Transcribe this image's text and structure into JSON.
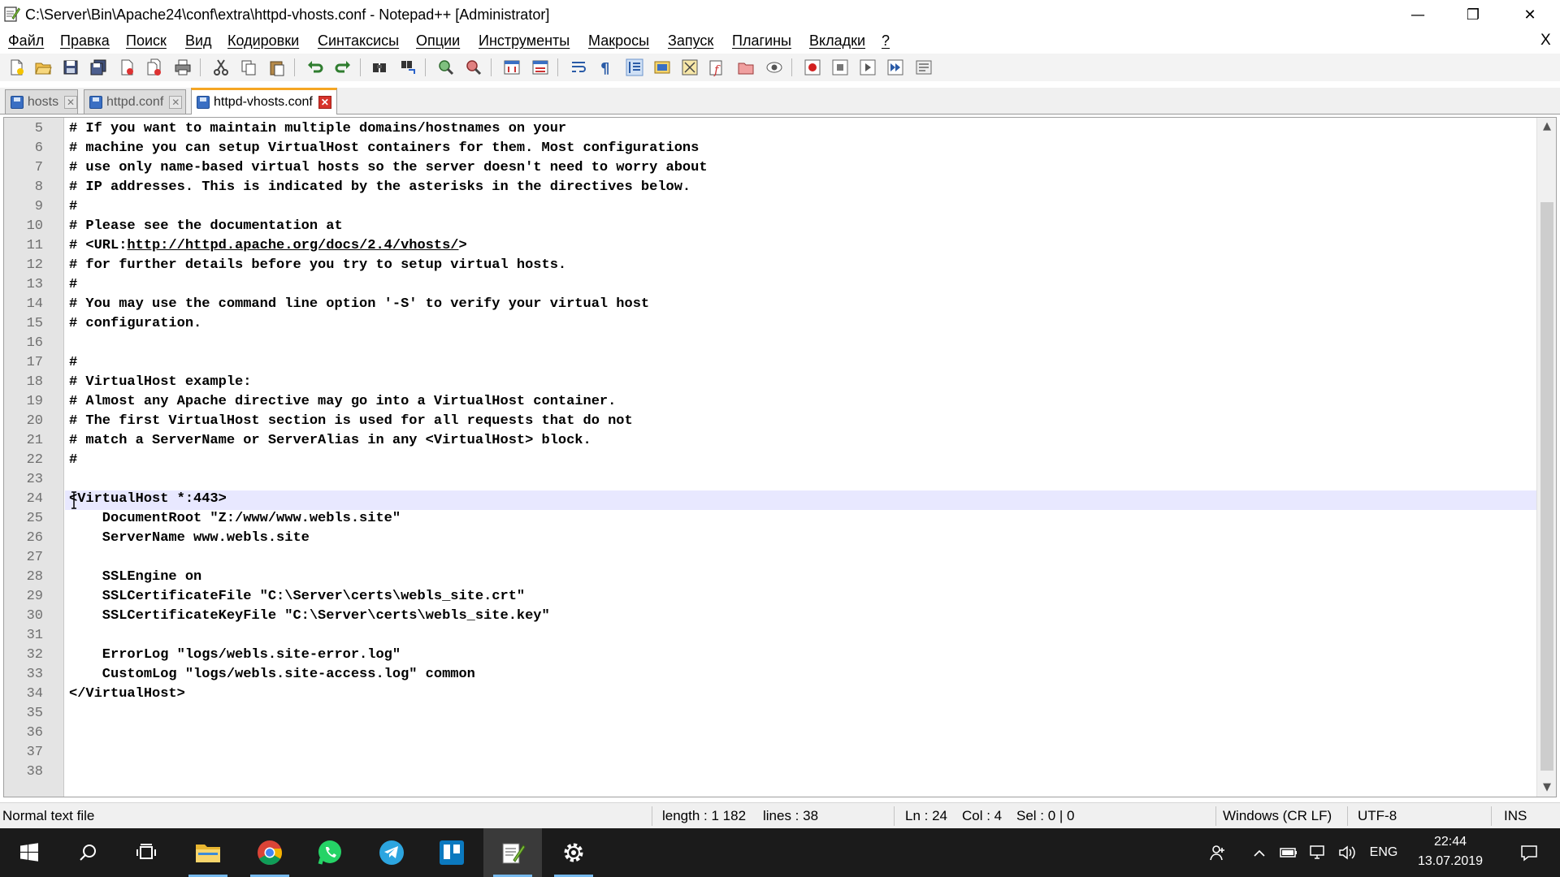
{
  "window": {
    "title": "C:\\Server\\Bin\\Apache24\\conf\\extra\\httpd-vhosts.conf - Notepad++ [Administrator]",
    "controls": {
      "minimize": "—",
      "maximize": "❐",
      "close": "✕"
    }
  },
  "menu": {
    "items": [
      "Файл",
      "Правка",
      "Поиск",
      "Вид",
      "Кодировки",
      "Синтаксисы",
      "Опции",
      "Инструменты",
      "Макросы",
      "Запуск",
      "Плагины",
      "Вкладки",
      "?"
    ],
    "close_doc": "X"
  },
  "toolbar": {
    "icons": [
      "new-file-icon",
      "open-file-icon",
      "save-icon",
      "save-all-icon",
      "close-icon",
      "close-all-icon",
      "print-icon",
      "cut-icon",
      "copy-icon",
      "paste-icon",
      "undo-icon",
      "redo-icon",
      "find-icon",
      "replace-icon",
      "zoom-in-icon",
      "zoom-out-icon",
      "sync-vertical-icon",
      "sync-horizontal-icon",
      "word-wrap-icon",
      "show-all-chars-icon",
      "indent-guide-icon",
      "user-language-icon",
      "doc-map-icon",
      "function-list-icon",
      "folder-workspace-icon",
      "monitoring-icon",
      "record-macro-icon",
      "stop-macro-icon",
      "play-macro-icon",
      "run-macro-multiple-icon",
      "save-macro-icon"
    ]
  },
  "tabs": [
    {
      "label": "hosts",
      "active": false
    },
    {
      "label": "httpd.conf",
      "active": false
    },
    {
      "label": "httpd-vhosts.conf",
      "active": true
    }
  ],
  "editor": {
    "current_line": 24,
    "lines": [
      {
        "num": "5",
        "text": "# If you want to maintain multiple domains/hostnames on your"
      },
      {
        "num": "6",
        "text": "# machine you can setup VirtualHost containers for them. Most configurations"
      },
      {
        "num": "7",
        "text": "# use only name-based virtual hosts so the server doesn't need to worry about"
      },
      {
        "num": "8",
        "text": "# IP addresses. This is indicated by the asterisks in the directives below."
      },
      {
        "num": "9",
        "text": "#"
      },
      {
        "num": "10",
        "text": "# Please see the documentation at"
      },
      {
        "num": "11",
        "text": "# <URL:http://httpd.apache.org/docs/2.4/vhosts/>",
        "url": "http://httpd.apache.org/docs/2.4/vhosts/"
      },
      {
        "num": "12",
        "text": "# for further details before you try to setup virtual hosts."
      },
      {
        "num": "13",
        "text": "#"
      },
      {
        "num": "14",
        "text": "# You may use the command line option '-S' to verify your virtual host"
      },
      {
        "num": "15",
        "text": "# configuration."
      },
      {
        "num": "16",
        "text": ""
      },
      {
        "num": "17",
        "text": "#"
      },
      {
        "num": "18",
        "text": "# VirtualHost example:"
      },
      {
        "num": "19",
        "text": "# Almost any Apache directive may go into a VirtualHost container."
      },
      {
        "num": "20",
        "text": "# The first VirtualHost section is used for all requests that do not"
      },
      {
        "num": "21",
        "text": "# match a ServerName or ServerAlias in any <VirtualHost> block."
      },
      {
        "num": "22",
        "text": "#"
      },
      {
        "num": "23",
        "text": ""
      },
      {
        "num": "24",
        "text": "<VirtualHost *:443>"
      },
      {
        "num": "25",
        "text": "    DocumentRoot \"Z:/www/www.webls.site\""
      },
      {
        "num": "26",
        "text": "    ServerName www.webls.site"
      },
      {
        "num": "27",
        "text": ""
      },
      {
        "num": "28",
        "text": "    SSLEngine on"
      },
      {
        "num": "29",
        "text": "    SSLCertificateFile \"C:\\Server\\certs\\webls_site.crt\""
      },
      {
        "num": "30",
        "text": "    SSLCertificateKeyFile \"C:\\Server\\certs\\webls_site.key\""
      },
      {
        "num": "31",
        "text": ""
      },
      {
        "num": "32",
        "text": "    ErrorLog \"logs/webls.site-error.log\""
      },
      {
        "num": "33",
        "text": "    CustomLog \"logs/webls.site-access.log\" common"
      },
      {
        "num": "34",
        "text": "</VirtualHost>"
      },
      {
        "num": "35",
        "text": ""
      },
      {
        "num": "36",
        "text": ""
      },
      {
        "num": "37",
        "text": ""
      },
      {
        "num": "38",
        "text": ""
      }
    ]
  },
  "status": {
    "file_type": "Normal text file",
    "length": "length : 1 182",
    "lines": "lines : 38",
    "ln": "Ln : 24",
    "col": "Col : 4",
    "sel": "Sel : 0 | 0",
    "eol": "Windows (CR LF)",
    "encoding": "UTF-8",
    "mode": "INS"
  },
  "taskbar": {
    "apps": [
      "windows-start-icon",
      "search-icon",
      "task-view-icon",
      "file-explorer-icon",
      "chrome-icon",
      "whatsapp-icon",
      "telegram-icon",
      "trello-icon",
      "notepadpp-icon",
      "settings-gear-icon"
    ],
    "tray": {
      "language": "ENG",
      "time": "22:44",
      "date": "13.07.2019"
    }
  },
  "colors": {
    "current_line_highlight": "#e8e8ff",
    "gutter_bg": "#e4e4e4",
    "active_tab_accent": "#f5a623",
    "taskbar_bg": "#1b1b1b"
  }
}
